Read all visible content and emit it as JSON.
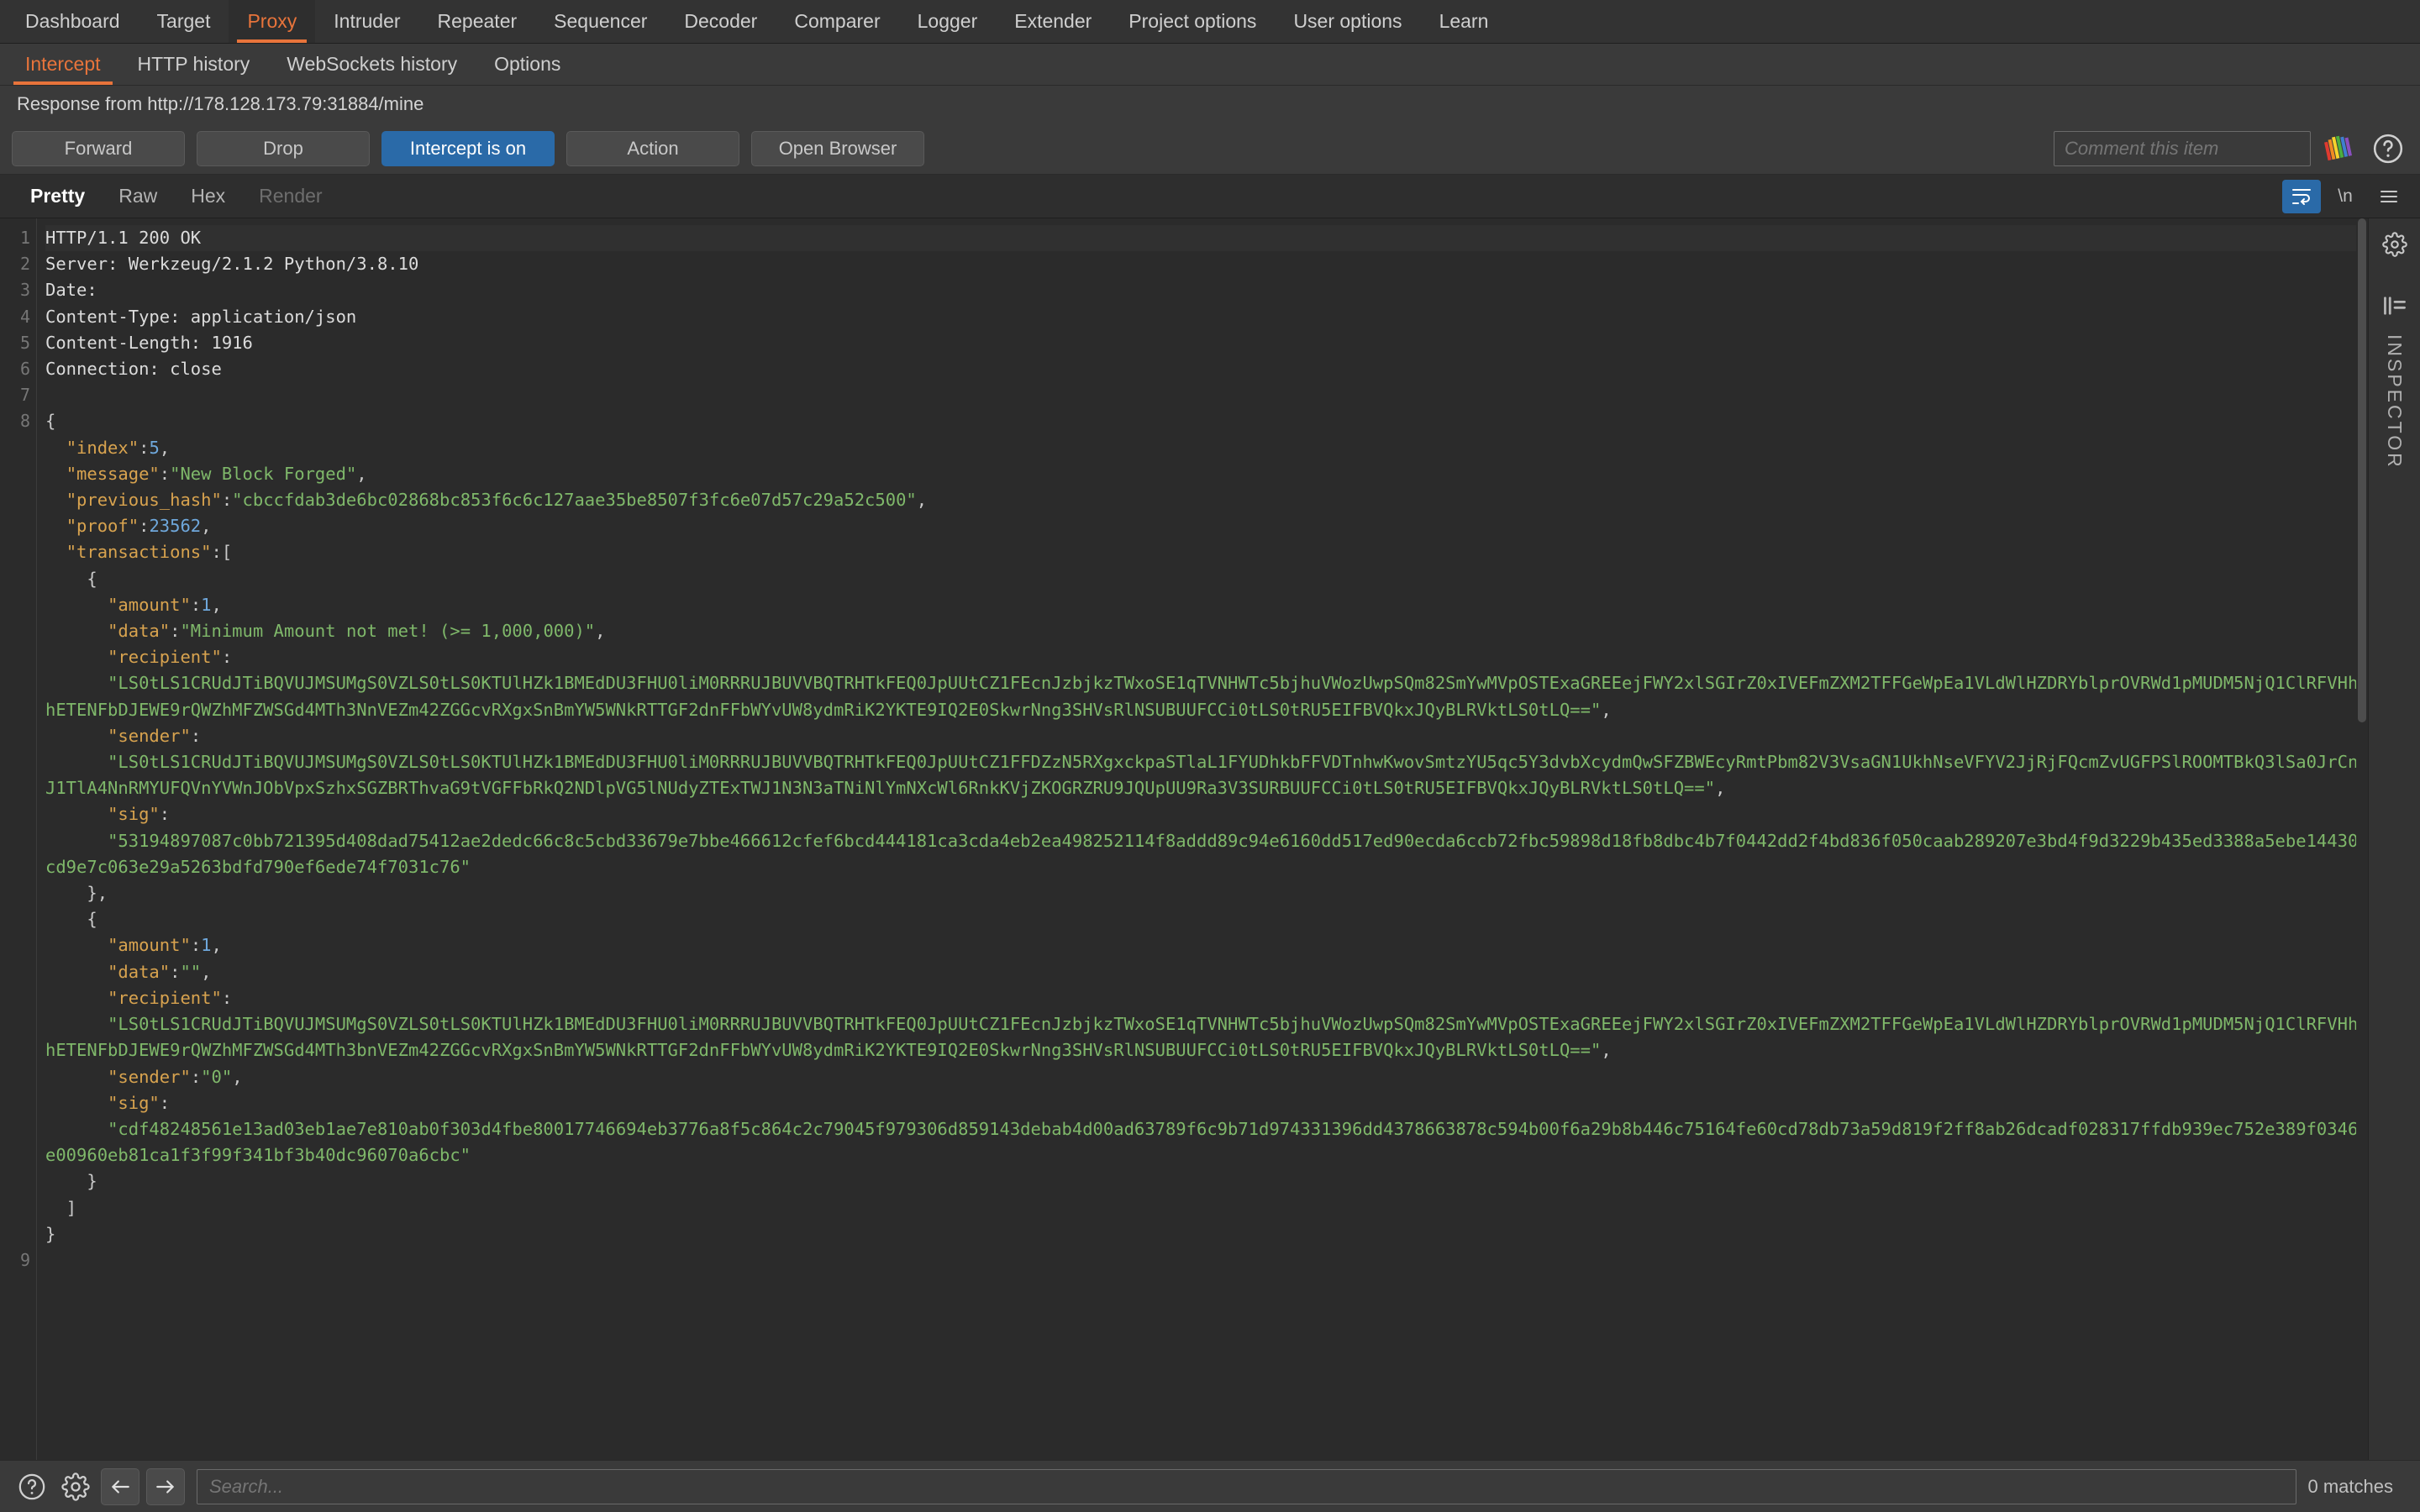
{
  "main_tabs": [
    {
      "label": "Dashboard",
      "active": false
    },
    {
      "label": "Target",
      "active": false
    },
    {
      "label": "Proxy",
      "active": true
    },
    {
      "label": "Intruder",
      "active": false
    },
    {
      "label": "Repeater",
      "active": false
    },
    {
      "label": "Sequencer",
      "active": false
    },
    {
      "label": "Decoder",
      "active": false
    },
    {
      "label": "Comparer",
      "active": false
    },
    {
      "label": "Logger",
      "active": false
    },
    {
      "label": "Extender",
      "active": false
    },
    {
      "label": "Project options",
      "active": false
    },
    {
      "label": "User options",
      "active": false
    },
    {
      "label": "Learn",
      "active": false
    }
  ],
  "sub_tabs": [
    {
      "label": "Intercept",
      "active": true
    },
    {
      "label": "HTTP history",
      "active": false
    },
    {
      "label": "WebSockets history",
      "active": false
    },
    {
      "label": "Options",
      "active": false
    }
  ],
  "info_bar": {
    "text": "Response from http://178.128.173.79:31884/mine"
  },
  "action_bar": {
    "forward": "Forward",
    "drop": "Drop",
    "intercept_toggle": "Intercept is on",
    "action": "Action",
    "open_browser": "Open Browser",
    "comment_placeholder": "Comment this item",
    "accent_color": "#2a6aa8"
  },
  "editor_tabs": [
    {
      "label": "Pretty",
      "active": true,
      "disabled": false
    },
    {
      "label": "Raw",
      "active": false,
      "disabled": false
    },
    {
      "label": "Hex",
      "active": false,
      "disabled": false
    },
    {
      "label": "Render",
      "active": false,
      "disabled": true
    }
  ],
  "editor_tools": {
    "word_wrap": "word-wrap-icon",
    "newline": "\\n",
    "menu": "hamburger-menu-icon"
  },
  "inspector": {
    "label": "INSPECTOR",
    "gear": "gear-icon",
    "bars": "inspector-bars-icon"
  },
  "status_bar": {
    "help": "help-circle-icon",
    "settings": "gear-icon",
    "back": "arrow-left-icon",
    "forward": "arrow-right-icon",
    "search_placeholder": "Search...",
    "matches": "0 matches"
  },
  "code": {
    "line_numbers": [
      "1",
      "2",
      "3",
      "4",
      "5",
      "6",
      "7",
      "8",
      "",
      "",
      "",
      "",
      "",
      "",
      "",
      "",
      "",
      "",
      "",
      "",
      "",
      "",
      "",
      "",
      "",
      "",
      "",
      "",
      "",
      "",
      "",
      "",
      "",
      "",
      "",
      "",
      "",
      "",
      "",
      "",
      "",
      "",
      "9"
    ],
    "lines": [
      {
        "n": 1,
        "hl": true,
        "segments": [
          {
            "t": "HTTP/1.1 200 OK",
            "c": "hdr"
          }
        ]
      },
      {
        "n": 2,
        "segments": [
          {
            "t": "Server: Werkzeug/2.1.2 Python/3.8.10",
            "c": "hdr"
          }
        ]
      },
      {
        "n": 3,
        "segments": [
          {
            "t": "Date: ",
            "c": "hdr"
          }
        ]
      },
      {
        "n": 4,
        "segments": [
          {
            "t": "Content-Type: application/json",
            "c": "hdr"
          }
        ]
      },
      {
        "n": 5,
        "segments": [
          {
            "t": "Content-Length: 1916",
            "c": "hdr"
          }
        ]
      },
      {
        "n": 6,
        "segments": [
          {
            "t": "Connection: close",
            "c": "hdr"
          }
        ]
      },
      {
        "n": 7,
        "segments": [
          {
            "t": "",
            "c": "p"
          }
        ]
      },
      {
        "n": 8,
        "segments": [
          {
            "t": "{",
            "c": "p"
          }
        ]
      },
      {
        "n": null,
        "segments": [
          {
            "t": "  \"index\"",
            "c": "k"
          },
          {
            "t": ":",
            "c": "p"
          },
          {
            "t": "5",
            "c": "n"
          },
          {
            "t": ",",
            "c": "p"
          }
        ]
      },
      {
        "n": null,
        "segments": [
          {
            "t": "  \"message\"",
            "c": "k"
          },
          {
            "t": ":",
            "c": "p"
          },
          {
            "t": "\"New Block Forged\"",
            "c": "s"
          },
          {
            "t": ",",
            "c": "p"
          }
        ]
      },
      {
        "n": null,
        "segments": [
          {
            "t": "  \"previous_hash\"",
            "c": "k"
          },
          {
            "t": ":",
            "c": "p"
          },
          {
            "t": "\"cbccfdab3de6bc02868bc853f6c6c127aae35be8507f3fc6e07d57c29a52c500\"",
            "c": "s"
          },
          {
            "t": ",",
            "c": "p"
          }
        ]
      },
      {
        "n": null,
        "segments": [
          {
            "t": "  \"proof\"",
            "c": "k"
          },
          {
            "t": ":",
            "c": "p"
          },
          {
            "t": "23562",
            "c": "n"
          },
          {
            "t": ",",
            "c": "p"
          }
        ]
      },
      {
        "n": null,
        "segments": [
          {
            "t": "  \"transactions\"",
            "c": "k"
          },
          {
            "t": ":[",
            "c": "p"
          }
        ]
      },
      {
        "n": null,
        "segments": [
          {
            "t": "    {",
            "c": "p"
          }
        ]
      },
      {
        "n": null,
        "segments": [
          {
            "t": "      \"amount\"",
            "c": "k"
          },
          {
            "t": ":",
            "c": "p"
          },
          {
            "t": "1",
            "c": "n"
          },
          {
            "t": ",",
            "c": "p"
          }
        ]
      },
      {
        "n": null,
        "segments": [
          {
            "t": "      \"data\"",
            "c": "k"
          },
          {
            "t": ":",
            "c": "p"
          },
          {
            "t": "\"Minimum Amount not met! (>= 1,000,000)\"",
            "c": "s"
          },
          {
            "t": ",",
            "c": "p"
          }
        ]
      },
      {
        "n": null,
        "segments": [
          {
            "t": "      \"recipient\"",
            "c": "k"
          },
          {
            "t": ":",
            "c": "p"
          }
        ]
      },
      {
        "n": null,
        "segments": [
          {
            "t": "      \"LS0tLS1CRUdJTiBQVUJMSUMgS0VZLS0tLS0KTUlHZk1BMEdDU3FHU0liM0RRRUJBUVVBQTRHTkFEQ0JpUUtCZ1FEcnJzbjkzTWxoSE1qTVNHWTc5bjhuVWozUwpSQm82SmYwMVpOSTExaGREEejFWY2xlSGIrZ0xIVEFmZXM2TFFGeWpEa1VLdWlHZDRYblprOVRWd1pMUDM5NjQ1ClRFVHhhETENFbDJEWE9rQWZhMFZWSGd4MTh3NnVEZm42ZGGcvRXgxSnBmYW5WNkRTTGF2dnFFbWYvUW8ydmRiK2YKTE9IQ2E0SkwrNng3SHVsRlNSUBUUFCCi0tLS0tRU5EIFBVQkxJQyBLRVktLS0tLQ==\"",
            "c": "s"
          },
          {
            "t": ",",
            "c": "p"
          }
        ]
      },
      {
        "n": null,
        "segments": [
          {
            "t": "      \"sender\"",
            "c": "k"
          },
          {
            "t": ":",
            "c": "p"
          }
        ]
      },
      {
        "n": null,
        "segments": [
          {
            "t": "      \"LS0tLS1CRUdJTiBQVUJMSUMgS0VZLS0tLS0KTUlHZk1BMEdDU3FHU0liM0RRRUJBUVVBQTRHTkFEQ0JpUUtCZ1FFDZzN5RXgxckpaSTlaL1FYUDhkbFFVDTnhwKwovSmtzYU5qc5Y3dvbXcydmQwSFZBWEcyRmtPbm82V3VsaGN1UkhNseVFYV2JjRjFQcmZvUGFPSlROOMTBkQ3lSa0JrCnJ1TlA4NnRMYUFQVnYVWnJObVpxSzhxSGZBRThvaG9tVGFFbRkQ2NDlpVG5lNUdyZTExTWJ1N3N3aTNiNlYmNXcWl6RnkKVjZKOGRZRU9JQUpUU9Ra3V3SURBUUFCCi0tLS0tRU5EIFBVQkxJQyBLRVktLS0tLQ==\"",
            "c": "s"
          },
          {
            "t": ",",
            "c": "p"
          }
        ]
      },
      {
        "n": null,
        "segments": [
          {
            "t": "      \"sig\"",
            "c": "k"
          },
          {
            "t": ":",
            "c": "p"
          }
        ]
      },
      {
        "n": null,
        "segments": [
          {
            "t": "      \"53194897087c0bb721395d408dad75412ae2dedc66c8c5cbd33679e7bbe466612cfef6bcd444181ca3cda4eb2ea498252114f8addd89c94e6160dd517ed90ecda6ccb72fbc59898d18fb8dbc4b7f0442dd2f4bd836f050caab289207e3bd4f9d3229b435ed3388a5ebe14430cd9e7c063e29a5263bdfd790ef6ede74f7031c76\"",
            "c": "s"
          }
        ]
      },
      {
        "n": null,
        "segments": [
          {
            "t": "    },",
            "c": "p"
          }
        ]
      },
      {
        "n": null,
        "segments": [
          {
            "t": "    {",
            "c": "p"
          }
        ]
      },
      {
        "n": null,
        "segments": [
          {
            "t": "      \"amount\"",
            "c": "k"
          },
          {
            "t": ":",
            "c": "p"
          },
          {
            "t": "1",
            "c": "n"
          },
          {
            "t": ",",
            "c": "p"
          }
        ]
      },
      {
        "n": null,
        "segments": [
          {
            "t": "      \"data\"",
            "c": "k"
          },
          {
            "t": ":",
            "c": "p"
          },
          {
            "t": "\"\"",
            "c": "s"
          },
          {
            "t": ",",
            "c": "p"
          }
        ]
      },
      {
        "n": null,
        "segments": [
          {
            "t": "      \"recipient\"",
            "c": "k"
          },
          {
            "t": ":",
            "c": "p"
          }
        ]
      },
      {
        "n": null,
        "segments": [
          {
            "t": "      \"LS0tLS1CRUdJTiBQVUJMSUMgS0VZLS0tLS0KTUlHZk1BMEdDU3FHU0liM0RRRUJBUVVBQTRHTkFEQ0JpUUtCZ1FEcnJzbjkzTWxoSE1qTVNHWTc5bjhuVWozUwpSQm82SmYwMVpOSTExaGREEejFWY2xlSGIrZ0xIVEFmZXM2TFFGeWpEa1VLdWlHZDRYblprOVRWd1pMUDM5NjQ1ClRFVHhhETENFbDJEWE9rQWZhMFZWSGd4MTh3bnVEZm42ZGGcvRXgxSnBmYW5WNkRTTGF2dnFFbWYvUW8ydmRiK2YKTE9IQ2E0SkwrNng3SHVsRlNSUBUUFCCi0tLS0tRU5EIFBVQkxJQyBLRVktLS0tLQ==\"",
            "c": "s"
          },
          {
            "t": ",",
            "c": "p"
          }
        ]
      },
      {
        "n": null,
        "segments": [
          {
            "t": "      \"sender\"",
            "c": "k"
          },
          {
            "t": ":",
            "c": "p"
          },
          {
            "t": "\"0\"",
            "c": "s"
          },
          {
            "t": ",",
            "c": "p"
          }
        ]
      },
      {
        "n": null,
        "segments": [
          {
            "t": "      \"sig\"",
            "c": "k"
          },
          {
            "t": ":",
            "c": "p"
          }
        ]
      },
      {
        "n": null,
        "segments": [
          {
            "t": "      \"cdf48248561e13ad03eb1ae7e810ab0f303d4fbe80017746694eb3776a8f5c864c2c79045f979306d859143debab4d00ad63789f6c9b71d974331396dd4378663878c594b00f6a29b8b446c75164fe60cd78db73a59d819f2ff8ab26dcadf028317ffdb939ec752e389f0346e00960eb81ca1f3f99f341bf3b40dc96070a6cbc\"",
            "c": "s"
          }
        ]
      },
      {
        "n": null,
        "segments": [
          {
            "t": "    }",
            "c": "p"
          }
        ]
      },
      {
        "n": null,
        "segments": [
          {
            "t": "  ]",
            "c": "p"
          }
        ]
      },
      {
        "n": null,
        "segments": [
          {
            "t": "}",
            "c": "p"
          }
        ]
      },
      {
        "n": 9,
        "segments": [
          {
            "t": "",
            "c": "p"
          }
        ]
      }
    ]
  }
}
